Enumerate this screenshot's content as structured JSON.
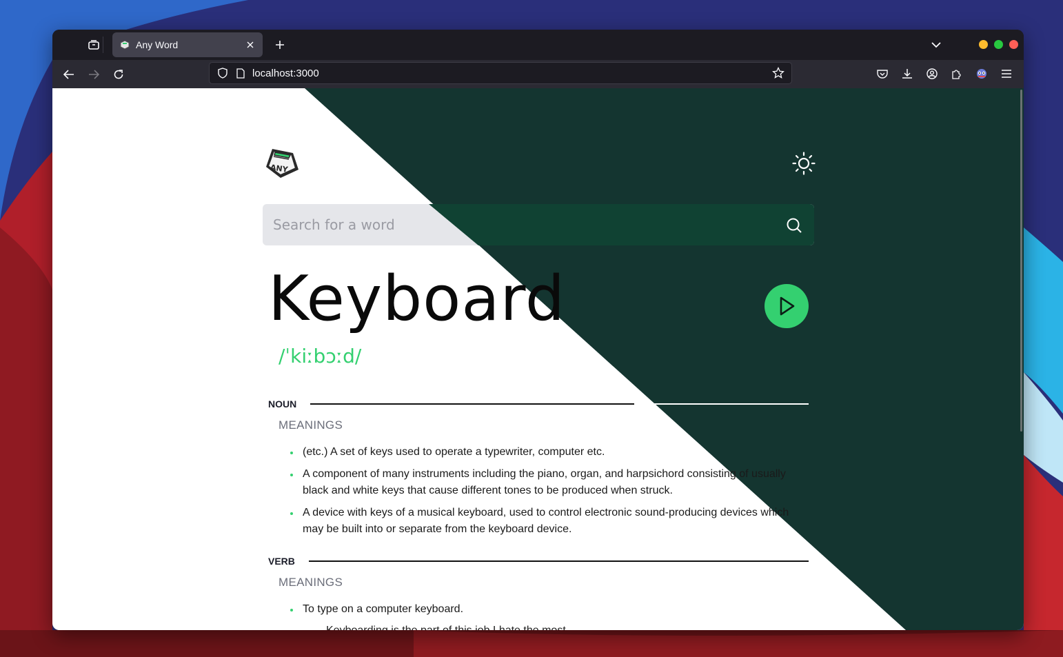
{
  "browser": {
    "tab_title": "Any Word",
    "url": "localhost:3000",
    "colors": {
      "close": "#ff5f57",
      "minimize": "#febc2e",
      "maximize": "#28c840"
    }
  },
  "app": {
    "logo_text": "ANY",
    "search_placeholder": "Search for a word",
    "word": "Keyboard",
    "phonetic": "/ˈkiːbɔːd/",
    "accent_color": "#34d070",
    "dark_bg": "#143530",
    "sections": [
      {
        "part_of_speech": "NOUN",
        "meanings_label": "MEANINGS",
        "definitions": [
          "(etc.) A set of keys used to operate a typewriter, computer etc.",
          "A component of many instruments including the piano, organ, and harpsichord consisting of usually black and white keys that cause different tones to be produced when struck.",
          "A device with keys of a musical keyboard, used to control electronic sound-producing devices which may be built into or separate from the keyboard device."
        ]
      },
      {
        "part_of_speech": "VERB",
        "meanings_label": "MEANINGS",
        "definitions": [
          "To type on a computer keyboard."
        ],
        "example": "Keyboarding is the part of this job I hate the most."
      }
    ]
  }
}
